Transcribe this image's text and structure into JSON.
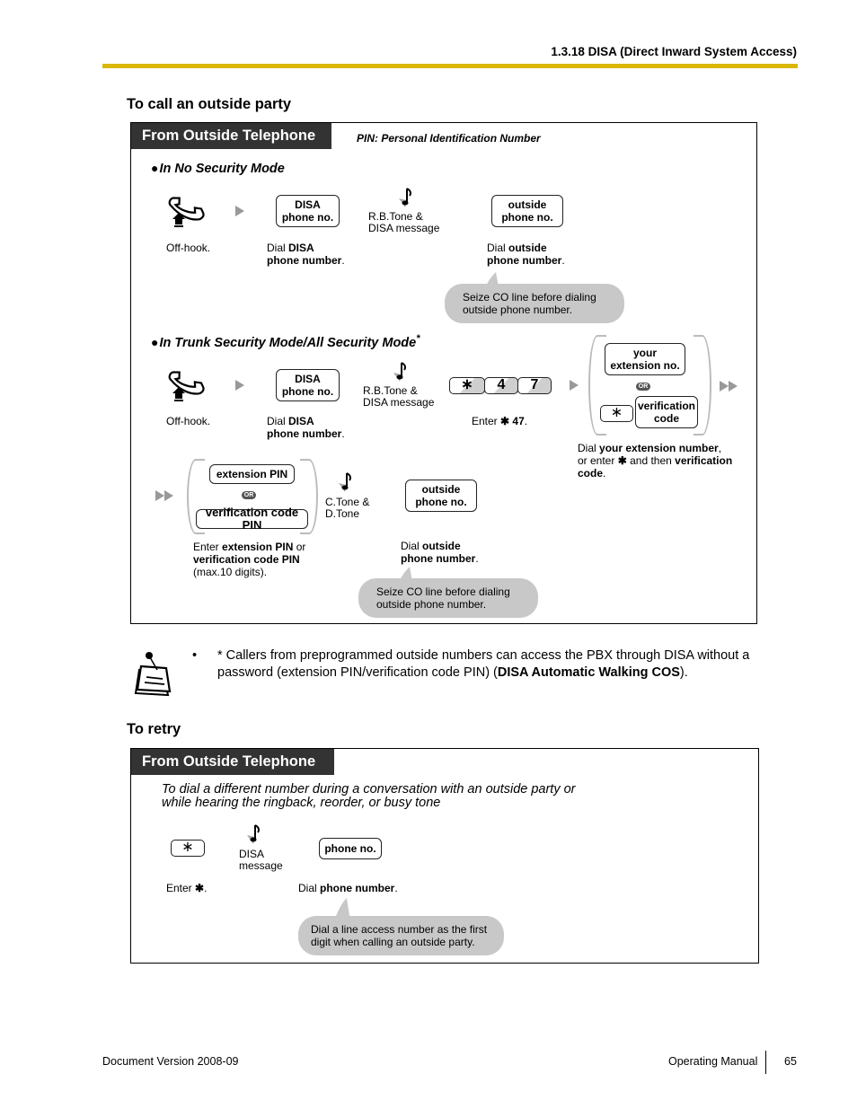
{
  "header": {
    "section_title": "1.3.18 DISA (Direct Inward System Access)"
  },
  "colors": {
    "header_rule": "#d9b700",
    "tab_bg": "#333333",
    "bubble_bg": "#c8c8c8",
    "arrow": "#999999"
  },
  "call_outside": {
    "title": "To call an outside party",
    "panel_tab": "From Outside Telephone",
    "pin_note": "PIN: Personal Identification Number",
    "no_security": {
      "mode_title": "In No Security Mode",
      "offhook_label": "Off-hook.",
      "disa_key": [
        "DISA",
        "phone no."
      ],
      "disa_label_prefix": "Dial ",
      "disa_label_bold1": "DISA",
      "disa_label_bold2": "phone number",
      "tone_label": [
        "R.B.Tone &",
        "DISA message"
      ],
      "outside_key": [
        "outside",
        "phone no."
      ],
      "outside_label_prefix": "Dial ",
      "outside_label_bold1": "outside",
      "outside_label_bold2": "phone number",
      "bubble": [
        "Seize CO line before dialing",
        "outside phone number."
      ]
    },
    "trunk_security": {
      "mode_title": "In Trunk Security Mode/All Security Mode",
      "asterisk": "*",
      "offhook_label": "Off-hook.",
      "disa_key": [
        "DISA",
        "phone no."
      ],
      "disa_label_prefix": "Dial ",
      "disa_label_bold1": "DISA",
      "disa_label_bold2": "phone number",
      "tone_label": [
        "R.B.Tone &",
        "DISA message"
      ],
      "keys": [
        "∗",
        "4",
        "7"
      ],
      "enter_label_prefix": "Enter ",
      "enter_label_bold": "✱ 47",
      "your_ext_key": [
        "your",
        "extension no."
      ],
      "or_label": "OR",
      "star_key": "∗",
      "verification_key": [
        "verification",
        "code"
      ],
      "choice_label": {
        "l1_prefix": "Dial ",
        "l1_bold": "your extension number",
        "l1_suffix": ",",
        "l2_prefix": "or enter ",
        "l2_star": "✱",
        "l2_mid": " and then ",
        "l2_bold": "verification",
        "l3_bold": "code"
      },
      "ext_pin_key": "extension PIN",
      "ver_pin_key": "verification code PIN",
      "pin_label": {
        "l1_prefix": "Enter ",
        "l1_bold": "extension PIN",
        "l1_suffix": " or",
        "l2_bold": "verification code PIN",
        "l3": "(max.10 digits)."
      },
      "tone2_label": [
        "C.Tone &",
        "D.Tone"
      ],
      "outside_key": [
        "outside",
        "phone no."
      ],
      "outside_label_prefix": "Dial ",
      "outside_label_bold1": "outside",
      "outside_label_bold2": "phone number",
      "bubble": [
        "Seize CO line before dialing",
        "outside phone number."
      ]
    }
  },
  "note": {
    "bullet": "•",
    "text_before": "* Callers from preprogrammed outside numbers can access the PBX through DISA without a password (extension PIN/verification code PIN) (",
    "text_bold": "DISA Automatic Walking COS",
    "text_after": ")."
  },
  "retry": {
    "title": "To retry",
    "panel_tab": "From Outside Telephone",
    "intro": [
      "To dial a different number during a conversation with an outside party or",
      "while hearing the ringback, reorder, or busy tone"
    ],
    "star_key": "∗",
    "tone_label": [
      "DISA",
      "message"
    ],
    "phone_key": "phone no.",
    "enter_label_prefix": "Enter ",
    "enter_label_bold": "✱",
    "dial_label_prefix": "Dial ",
    "dial_label_bold": "phone number",
    "bubble": [
      "Dial a line access number as the first",
      "digit when calling an outside party."
    ]
  },
  "footer": {
    "doc_version": "Document Version  2008-09",
    "manual": "Operating Manual",
    "page": "65"
  }
}
